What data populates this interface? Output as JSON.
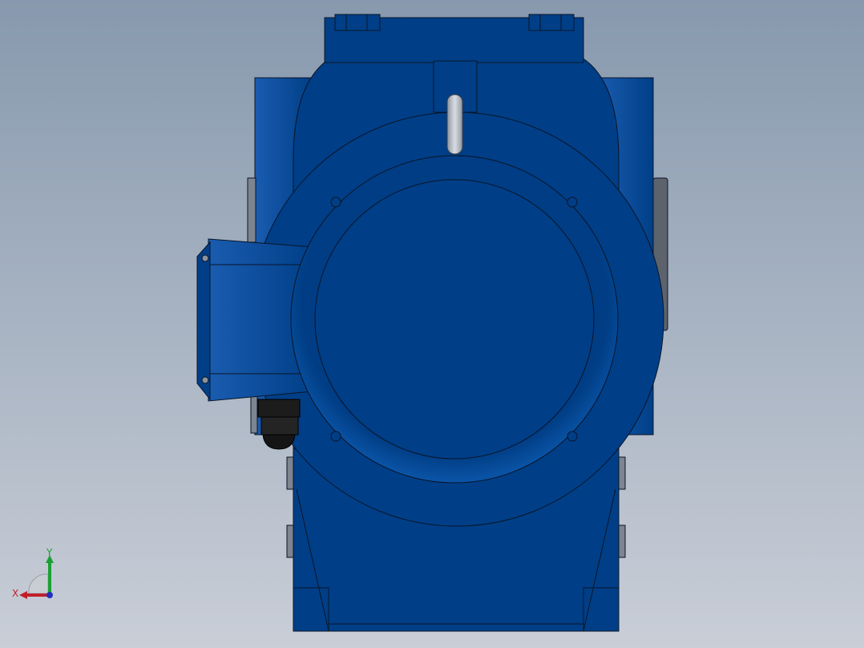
{
  "scene": {
    "model_color": "#003f87",
    "model_color_light": "#1a5cb0",
    "edge_color": "#0a1428",
    "background_top": "#8799ae",
    "background_bottom": "#c9ced7",
    "lifting_eye_color": "#b9bfc8",
    "cable_gland_color": "#1c1c1c"
  },
  "triad": {
    "x_label": "X",
    "y_label": "Y",
    "x_color": "#c0202a",
    "y_color": "#1aa032",
    "z_color": "#2030c0"
  }
}
